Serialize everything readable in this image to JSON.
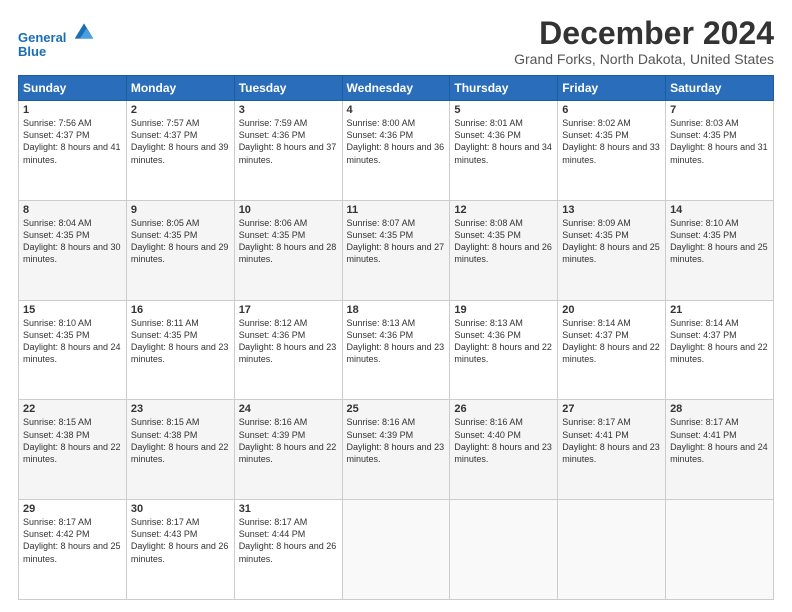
{
  "header": {
    "logo_line1": "General",
    "logo_line2": "Blue",
    "title": "December 2024",
    "subtitle": "Grand Forks, North Dakota, United States"
  },
  "columns": [
    "Sunday",
    "Monday",
    "Tuesday",
    "Wednesday",
    "Thursday",
    "Friday",
    "Saturday"
  ],
  "weeks": [
    [
      {
        "day": "1",
        "rise": "7:56 AM",
        "set": "4:37 PM",
        "daylight": "8 hours and 41 minutes."
      },
      {
        "day": "2",
        "rise": "7:57 AM",
        "set": "4:37 PM",
        "daylight": "8 hours and 39 minutes."
      },
      {
        "day": "3",
        "rise": "7:59 AM",
        "set": "4:36 PM",
        "daylight": "8 hours and 37 minutes."
      },
      {
        "day": "4",
        "rise": "8:00 AM",
        "set": "4:36 PM",
        "daylight": "8 hours and 36 minutes."
      },
      {
        "day": "5",
        "rise": "8:01 AM",
        "set": "4:36 PM",
        "daylight": "8 hours and 34 minutes."
      },
      {
        "day": "6",
        "rise": "8:02 AM",
        "set": "4:35 PM",
        "daylight": "8 hours and 33 minutes."
      },
      {
        "day": "7",
        "rise": "8:03 AM",
        "set": "4:35 PM",
        "daylight": "8 hours and 31 minutes."
      }
    ],
    [
      {
        "day": "8",
        "rise": "8:04 AM",
        "set": "4:35 PM",
        "daylight": "8 hours and 30 minutes."
      },
      {
        "day": "9",
        "rise": "8:05 AM",
        "set": "4:35 PM",
        "daylight": "8 hours and 29 minutes."
      },
      {
        "day": "10",
        "rise": "8:06 AM",
        "set": "4:35 PM",
        "daylight": "8 hours and 28 minutes."
      },
      {
        "day": "11",
        "rise": "8:07 AM",
        "set": "4:35 PM",
        "daylight": "8 hours and 27 minutes."
      },
      {
        "day": "12",
        "rise": "8:08 AM",
        "set": "4:35 PM",
        "daylight": "8 hours and 26 minutes."
      },
      {
        "day": "13",
        "rise": "8:09 AM",
        "set": "4:35 PM",
        "daylight": "8 hours and 25 minutes."
      },
      {
        "day": "14",
        "rise": "8:10 AM",
        "set": "4:35 PM",
        "daylight": "8 hours and 25 minutes."
      }
    ],
    [
      {
        "day": "15",
        "rise": "8:10 AM",
        "set": "4:35 PM",
        "daylight": "8 hours and 24 minutes."
      },
      {
        "day": "16",
        "rise": "8:11 AM",
        "set": "4:35 PM",
        "daylight": "8 hours and 23 minutes."
      },
      {
        "day": "17",
        "rise": "8:12 AM",
        "set": "4:36 PM",
        "daylight": "8 hours and 23 minutes."
      },
      {
        "day": "18",
        "rise": "8:13 AM",
        "set": "4:36 PM",
        "daylight": "8 hours and 23 minutes."
      },
      {
        "day": "19",
        "rise": "8:13 AM",
        "set": "4:36 PM",
        "daylight": "8 hours and 22 minutes."
      },
      {
        "day": "20",
        "rise": "8:14 AM",
        "set": "4:37 PM",
        "daylight": "8 hours and 22 minutes."
      },
      {
        "day": "21",
        "rise": "8:14 AM",
        "set": "4:37 PM",
        "daylight": "8 hours and 22 minutes."
      }
    ],
    [
      {
        "day": "22",
        "rise": "8:15 AM",
        "set": "4:38 PM",
        "daylight": "8 hours and 22 minutes."
      },
      {
        "day": "23",
        "rise": "8:15 AM",
        "set": "4:38 PM",
        "daylight": "8 hours and 22 minutes."
      },
      {
        "day": "24",
        "rise": "8:16 AM",
        "set": "4:39 PM",
        "daylight": "8 hours and 22 minutes."
      },
      {
        "day": "25",
        "rise": "8:16 AM",
        "set": "4:39 PM",
        "daylight": "8 hours and 23 minutes."
      },
      {
        "day": "26",
        "rise": "8:16 AM",
        "set": "4:40 PM",
        "daylight": "8 hours and 23 minutes."
      },
      {
        "day": "27",
        "rise": "8:17 AM",
        "set": "4:41 PM",
        "daylight": "8 hours and 23 minutes."
      },
      {
        "day": "28",
        "rise": "8:17 AM",
        "set": "4:41 PM",
        "daylight": "8 hours and 24 minutes."
      }
    ],
    [
      {
        "day": "29",
        "rise": "8:17 AM",
        "set": "4:42 PM",
        "daylight": "8 hours and 25 minutes."
      },
      {
        "day": "30",
        "rise": "8:17 AM",
        "set": "4:43 PM",
        "daylight": "8 hours and 26 minutes."
      },
      {
        "day": "31",
        "rise": "8:17 AM",
        "set": "4:44 PM",
        "daylight": "8 hours and 26 minutes."
      },
      null,
      null,
      null,
      null
    ]
  ]
}
